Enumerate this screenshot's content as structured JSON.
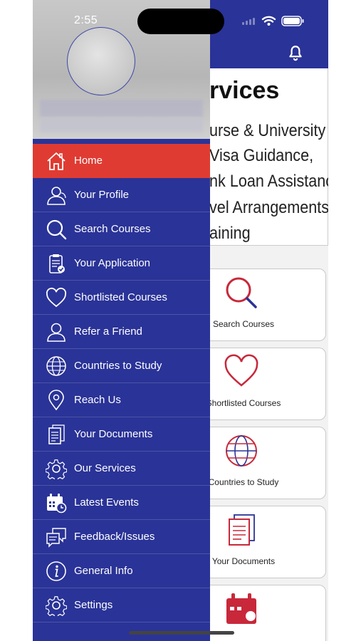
{
  "status": {
    "time": "2:55"
  },
  "banner": {
    "title": "rvices",
    "lines": [
      "urse & University",
      "Visa Guidance,",
      "nk Loan Assistance,",
      "vel Arrangements",
      "aining"
    ]
  },
  "cards": [
    {
      "label": "Search Courses",
      "icon": "search-icon"
    },
    {
      "label": "Shortlisted Courses",
      "icon": "heart-icon"
    },
    {
      "label": "Countries to Study",
      "icon": "globe-icon"
    },
    {
      "label": "Your Documents",
      "icon": "documents-icon"
    },
    {
      "label": "",
      "icon": "calendar-icon"
    }
  ],
  "drawer": {
    "items": [
      {
        "label": "Home",
        "icon": "home-icon"
      },
      {
        "label": "Your Profile",
        "icon": "user-icon"
      },
      {
        "label": "Search Courses",
        "icon": "search-icon"
      },
      {
        "label": "Your Application",
        "icon": "clipboard-check-icon"
      },
      {
        "label": "Shortlisted Courses",
        "icon": "heart-icon"
      },
      {
        "label": "Refer a Friend",
        "icon": "user-icon"
      },
      {
        "label": "Countries to Study",
        "icon": "globe-icon"
      },
      {
        "label": "Reach Us",
        "icon": "location-pin-icon"
      },
      {
        "label": "Your Documents",
        "icon": "document-icon"
      },
      {
        "label": "Our Services",
        "icon": "gear-icon"
      },
      {
        "label": "Latest Events",
        "icon": "calendar-clock-icon"
      },
      {
        "label": "Feedback/Issues",
        "icon": "chat-icon"
      },
      {
        "label": "General Info",
        "icon": "info-icon"
      },
      {
        "label": "Settings",
        "icon": "settings-icon"
      }
    ]
  },
  "colors": {
    "primary": "#2a3397",
    "active": "#e03b32",
    "accent_red": "#c8283a"
  }
}
